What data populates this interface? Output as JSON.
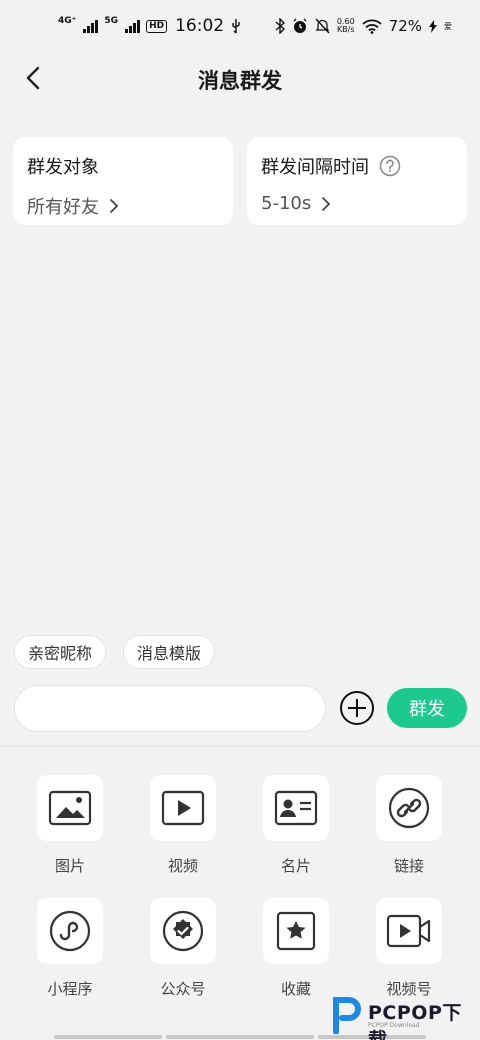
{
  "status_bar": {
    "sim1_label": "4G⁺",
    "sim2_label": "5G",
    "hd_label": "HD",
    "time": "16:02",
    "net_speed_value": "0.60",
    "net_speed_unit": "KB/s",
    "battery": "72%",
    "charge_label": "爱"
  },
  "header": {
    "title": "消息群发"
  },
  "cards": {
    "target": {
      "title": "群发对象",
      "value": "所有好友"
    },
    "interval": {
      "title": "群发间隔时间",
      "value": "5-10s"
    }
  },
  "chips": {
    "nickname": "亲密昵称",
    "template": "消息模版"
  },
  "composer": {
    "input_value": "",
    "input_placeholder": "",
    "send_label": "群发"
  },
  "tools": [
    {
      "label": "图片",
      "icon": "image-icon"
    },
    {
      "label": "视频",
      "icon": "video-icon"
    },
    {
      "label": "名片",
      "icon": "contact-card-icon"
    },
    {
      "label": "链接",
      "icon": "link-icon"
    },
    {
      "label": "小程序",
      "icon": "mini-program-icon"
    },
    {
      "label": "公众号",
      "icon": "official-account-icon"
    },
    {
      "label": "收藏",
      "icon": "favorites-icon"
    },
    {
      "label": "视频号",
      "icon": "channels-icon"
    }
  ],
  "watermark": {
    "brand": "PCPOP下载",
    "sub": "PCPOP Download"
  },
  "colors": {
    "accent": "#1cc98f",
    "background": "#f2f2f2",
    "card": "#ffffff"
  }
}
